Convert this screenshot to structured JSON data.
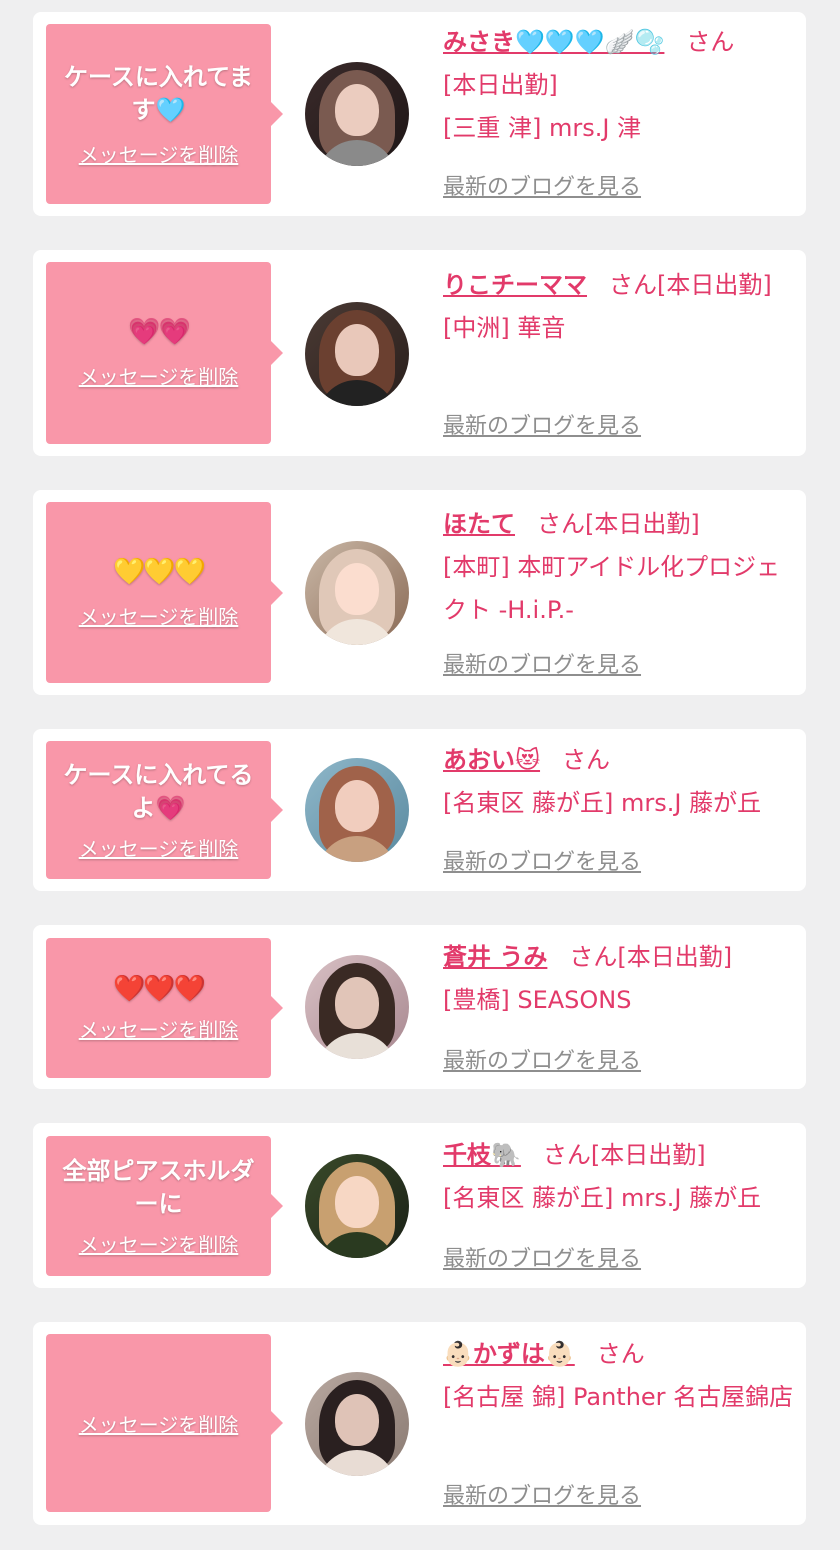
{
  "delete_label": "メッセージを削除",
  "san_label": "さん",
  "blog_label": "最新のブログを見る",
  "colors": {
    "page_bg": "#efeff0",
    "bubble": "#f997a9",
    "accent_text": "#e23a6a",
    "link_gray": "#8e8e8e"
  },
  "entries": [
    {
      "message": "ケースに入れてます🩵",
      "name": "みさき🩵🩵🩵🪽🫧",
      "attendance": "",
      "shop": "[三重 津] mrs.J 津",
      "shop_prefix": "[本日出勤]"
    },
    {
      "message": "💗💗",
      "name": "りこチーママ",
      "attendance": "[本日出勤]",
      "shop": "[中洲] 華音",
      "shop_prefix": ""
    },
    {
      "message": "💛💛💛",
      "name": "ほたて",
      "attendance": "[本日出勤]",
      "shop": "[本町] 本町アイドル化プロジェクト -H.i.P.-",
      "shop_prefix": ""
    },
    {
      "message": "ケースに入れてるよ💗",
      "name": "あおい😻",
      "attendance": "",
      "shop": "[名東区 藤が丘] mrs.J 藤が丘",
      "shop_prefix": ""
    },
    {
      "message": "❤️❤️❤️",
      "name": "蒼井 うみ",
      "attendance": "[本日出勤]",
      "shop": "[豊橋] SEASONS",
      "shop_prefix": ""
    },
    {
      "message": "全部ピアスホルダーに",
      "name": "千枝🐘",
      "attendance": "[本日出勤]",
      "shop": "[名東区 藤が丘] mrs.J 藤が丘",
      "shop_prefix": ""
    },
    {
      "message": "",
      "name": "👶🏻かずは👶🏻",
      "attendance": "",
      "shop": "[名古屋 錦] Panther 名古屋錦店",
      "shop_prefix": ""
    }
  ]
}
